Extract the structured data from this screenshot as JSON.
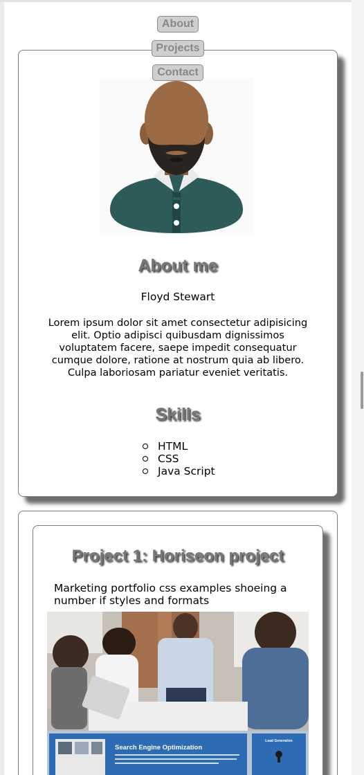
{
  "nav": {
    "items": [
      {
        "label": "About"
      },
      {
        "label": "Projects"
      },
      {
        "label": "Contact"
      }
    ]
  },
  "about": {
    "heading": "About me",
    "name": "Floyd Stewart",
    "bio": "Lorem ipsum dolor sit amet consectetur adipisicing elit. Optio adipisci quibusdam dignissimos voluptatem facere, saepe impedit consequatur cumque dolore, ratione at nostrum quia ab libero. Culpa laboriosam pariatur eveniet veritatis."
  },
  "skills": {
    "heading": "Skills",
    "items": [
      "HTML",
      "CSS",
      "Java Script"
    ]
  },
  "projects": {
    "items": [
      {
        "title": "Project 1: Horiseon project",
        "description": "Marketing portfolio css examples shoeing a number if styles and formats",
        "image": {
          "panel_title": "Search Engine Optimization",
          "side_title": "Lead Generation"
        }
      }
    ]
  },
  "colors": {
    "nav_bg": "#cfcfcf",
    "heading": "#777777",
    "card_border": "#7a7a7a",
    "shirt": "#2c5b5a",
    "seo_blue": "#2e6bb5"
  }
}
